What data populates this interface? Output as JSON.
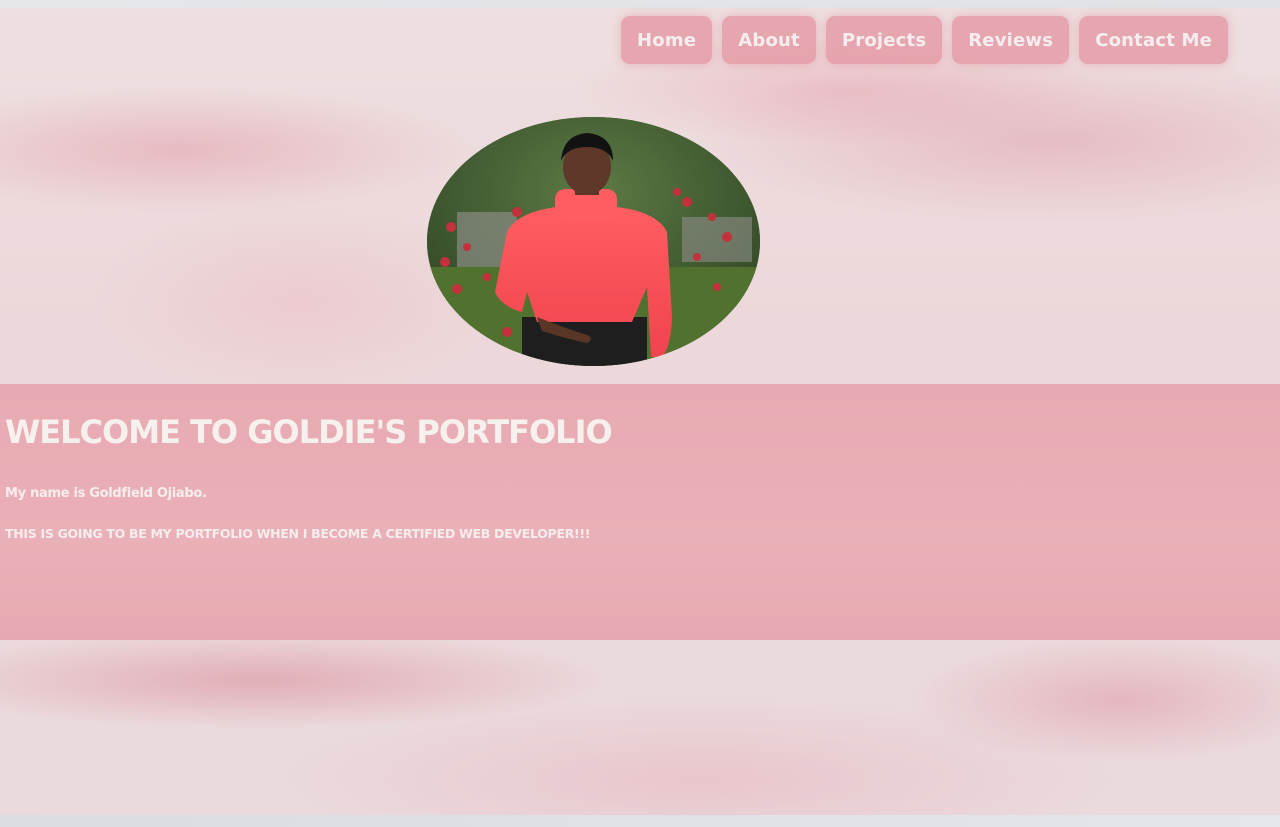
{
  "nav": {
    "items": [
      {
        "label": "Home"
      },
      {
        "label": "About"
      },
      {
        "label": "Projects"
      },
      {
        "label": "Reviews"
      },
      {
        "label": "Contact Me"
      }
    ]
  },
  "hero": {
    "avatar_alt": "Profile photo of Goldie in a coral turtleneck sweater in front of a rose garden"
  },
  "banner": {
    "title": "WELCOME TO GOLDIE'S PORTFOLIO",
    "line1": "My name is Goldfield Ojiabo.",
    "line2": "THIS IS GOING TO BE MY PORTFOLIO WHEN I BECOME A CERTIFIED WEB DEVELOPER!!!"
  },
  "colors": {
    "nav_button": "#e496a2",
    "banner": "#e8aab2",
    "text_light": "#f6eeee"
  }
}
